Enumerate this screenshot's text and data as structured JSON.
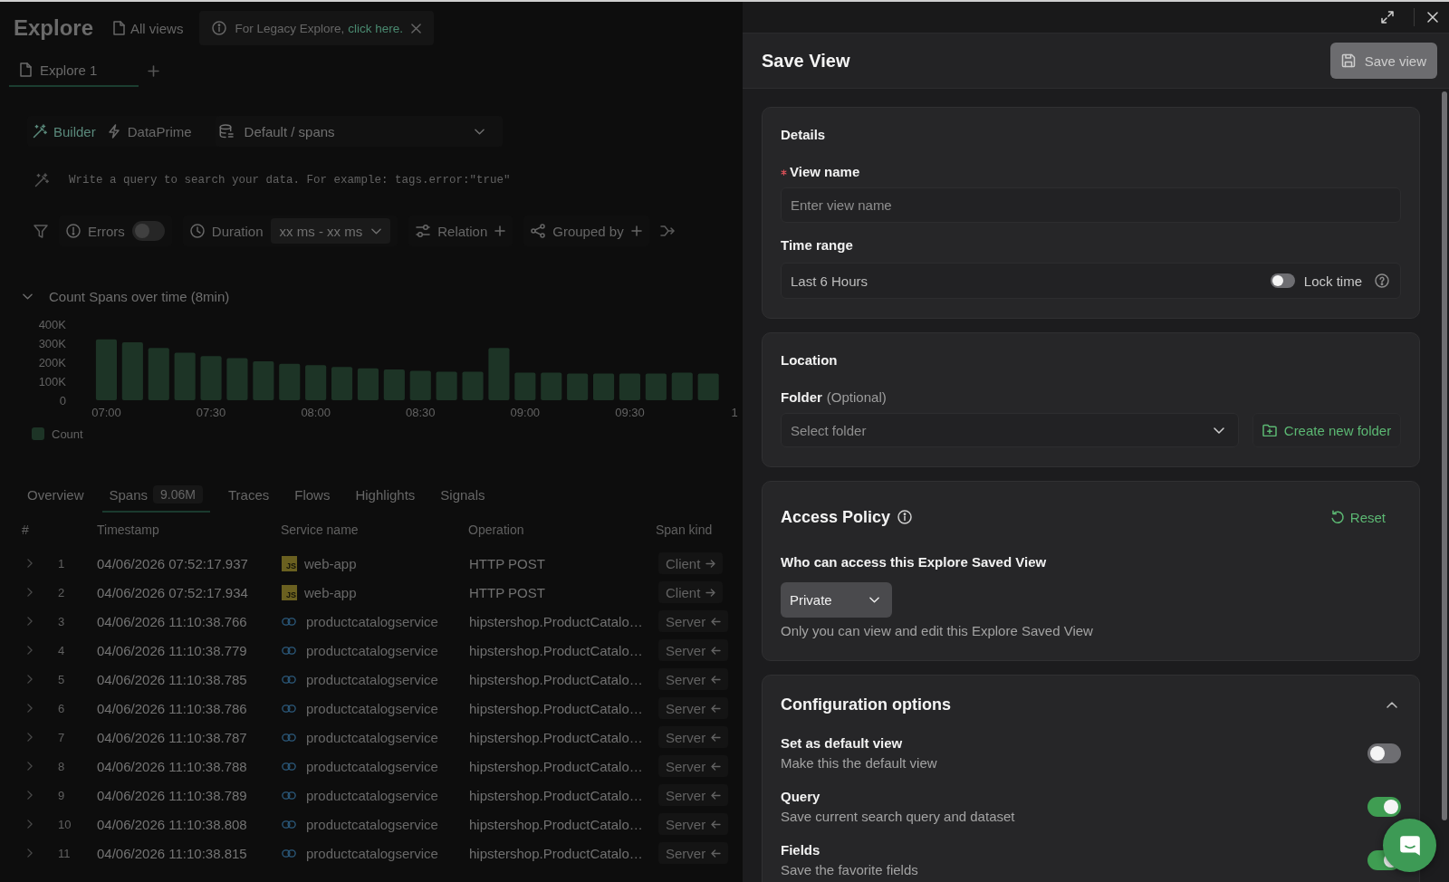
{
  "explore": {
    "header": {
      "title": "Explore",
      "all_views": "All views",
      "banner": {
        "text": "For Legacy Explore,",
        "link": "click here."
      }
    },
    "tabs": [
      {
        "label": "Explore 1",
        "selected": true
      }
    ],
    "query": {
      "modes": [
        {
          "label": "Builder",
          "selected": true
        },
        {
          "label": "DataPrime",
          "selected": false
        }
      ],
      "dataset": "Default / spans",
      "placeholder": "Write a query to search your data. For example: tags.error:\"true\""
    },
    "filters": [
      {
        "kind": "toggle",
        "label": "Errors",
        "on": false
      },
      {
        "kind": "range",
        "label": "Duration",
        "value": "xx ms - xx ms"
      },
      {
        "kind": "add",
        "label": "Relation"
      },
      {
        "kind": "add",
        "label": "Grouped by"
      }
    ],
    "chart": {
      "title": "Count Spans over time (8min)",
      "expanded": true,
      "chart_data": {
        "type": "bar",
        "categories": [
          "07:00",
          null,
          null,
          null,
          "07:30",
          null,
          null,
          null,
          "08:00",
          null,
          null,
          null,
          "08:30",
          null,
          null,
          null,
          "09:00",
          null,
          null,
          null,
          "09:30",
          null,
          null,
          null,
          "1"
        ],
        "series": [
          {
            "name": "Count",
            "color": "#1d3426",
            "values": [
              320000,
              305000,
              275000,
              250000,
              232000,
              222000,
              205000,
              192000,
              185000,
              175000,
              168000,
              162000,
              155000,
              150000,
              150000,
              275000,
              145000,
              145000,
              140000,
              140000,
              140000,
              140000,
              145000,
              140000,
              null
            ]
          }
        ],
        "ylim": [
          0,
          400000
        ],
        "yticks": [
          {
            "value": 0,
            "label": "0"
          },
          {
            "value": 100000,
            "label": "100K"
          },
          {
            "value": 200000,
            "label": "200K"
          },
          {
            "value": 300000,
            "label": "300K"
          },
          {
            "value": 400000,
            "label": "400K"
          }
        ]
      }
    },
    "result_tabs": [
      {
        "label": "Overview",
        "selected": false
      },
      {
        "label": "Spans",
        "badge": "9.06M",
        "selected": true
      },
      {
        "label": "Traces",
        "selected": false
      },
      {
        "label": "Flows",
        "selected": false
      },
      {
        "label": "Highlights",
        "selected": false
      },
      {
        "label": "Signals",
        "selected": false
      }
    ],
    "table": {
      "columns": [
        "#",
        "Timestamp",
        "Service name",
        "Operation",
        "Span kind"
      ],
      "rows": [
        {
          "number": "1",
          "timestamp": "04/06/2026 07:52:17.937",
          "service": {
            "kind": "js",
            "logo": "JS",
            "name": "web-app"
          },
          "operation": "HTTP POST",
          "span_kind": {
            "label": "Client",
            "kind": "outgoing"
          }
        },
        {
          "number": "2",
          "timestamp": "04/06/2026 07:52:17.934",
          "service": {
            "kind": "js",
            "logo": "JS",
            "name": "web-app"
          },
          "operation": "HTTP POST",
          "span_kind": {
            "label": "Client",
            "kind": "outgoing"
          }
        },
        {
          "number": "3",
          "timestamp": "04/06/2026 11:10:38.766",
          "service": {
            "kind": "go",
            "name": "productcatalogservice"
          },
          "operation": "hipstershop.ProductCatalo…",
          "span_kind": {
            "label": "Server",
            "kind": "incoming"
          }
        },
        {
          "number": "4",
          "timestamp": "04/06/2026 11:10:38.779",
          "service": {
            "kind": "go",
            "name": "productcatalogservice"
          },
          "operation": "hipstershop.ProductCatalo…",
          "span_kind": {
            "label": "Server",
            "kind": "incoming"
          }
        },
        {
          "number": "5",
          "timestamp": "04/06/2026 11:10:38.785",
          "service": {
            "kind": "go",
            "name": "productcatalogservice"
          },
          "operation": "hipstershop.ProductCatalo…",
          "span_kind": {
            "label": "Server",
            "kind": "incoming"
          }
        },
        {
          "number": "6",
          "timestamp": "04/06/2026 11:10:38.786",
          "service": {
            "kind": "go",
            "name": "productcatalogservice"
          },
          "operation": "hipstershop.ProductCatalo…",
          "span_kind": {
            "label": "Server",
            "kind": "incoming"
          }
        },
        {
          "number": "7",
          "timestamp": "04/06/2026 11:10:38.787",
          "service": {
            "kind": "go",
            "name": "productcatalogservice"
          },
          "operation": "hipstershop.ProductCatalo…",
          "span_kind": {
            "label": "Server",
            "kind": "incoming"
          }
        },
        {
          "number": "8",
          "timestamp": "04/06/2026 11:10:38.788",
          "service": {
            "kind": "go",
            "name": "productcatalogservice"
          },
          "operation": "hipstershop.ProductCatalo…",
          "span_kind": {
            "label": "Server",
            "kind": "incoming"
          }
        },
        {
          "number": "9",
          "timestamp": "04/06/2026 11:10:38.789",
          "service": {
            "kind": "go",
            "name": "productcatalogservice"
          },
          "operation": "hipstershop.ProductCatalo…",
          "span_kind": {
            "label": "Server",
            "kind": "incoming"
          }
        },
        {
          "number": "10",
          "timestamp": "04/06/2026 11:10:38.808",
          "service": {
            "kind": "go",
            "name": "productcatalogservice"
          },
          "operation": "hipstershop.ProductCatalo…",
          "span_kind": {
            "label": "Server",
            "kind": "incoming"
          }
        },
        {
          "number": "11",
          "timestamp": "04/06/2026 11:10:38.815",
          "service": {
            "kind": "go",
            "name": "productcatalogservice"
          },
          "operation": "hipstershop.ProductCatalo…",
          "span_kind": {
            "label": "Server",
            "kind": "incoming"
          }
        }
      ]
    }
  },
  "save_view_drawer": {
    "title": "Save View",
    "save_button": {
      "label": "Save view",
      "disabled": true
    },
    "details": {
      "heading": "Details",
      "view_name": {
        "label": "View name",
        "required": true,
        "placeholder": "Enter view name"
      },
      "time_range": {
        "label": "Time range",
        "value": "Last 6 Hours",
        "lock_time": {
          "label": "Lock time",
          "on": false
        }
      }
    },
    "location": {
      "heading": "Location",
      "folder": {
        "label": "Folder",
        "hint": "(Optional)",
        "placeholder": "Select folder"
      },
      "create_folder_button": "Create new folder"
    },
    "access_policy": {
      "heading": "Access Policy",
      "reset_button": "Reset",
      "question": "Who can access this Explore Saved View",
      "access": "Private",
      "description": "Only you can view and edit this Explore Saved View"
    },
    "configuration": {
      "heading": "Configuration options",
      "expanded": true,
      "options": [
        {
          "title": "Set as default view",
          "description": "Make this the default view",
          "on": false
        },
        {
          "title": "Query",
          "description": "Save current search query and dataset",
          "on": true
        },
        {
          "title": "Fields",
          "description": "Save the favorite fields",
          "on": true
        }
      ]
    }
  }
}
